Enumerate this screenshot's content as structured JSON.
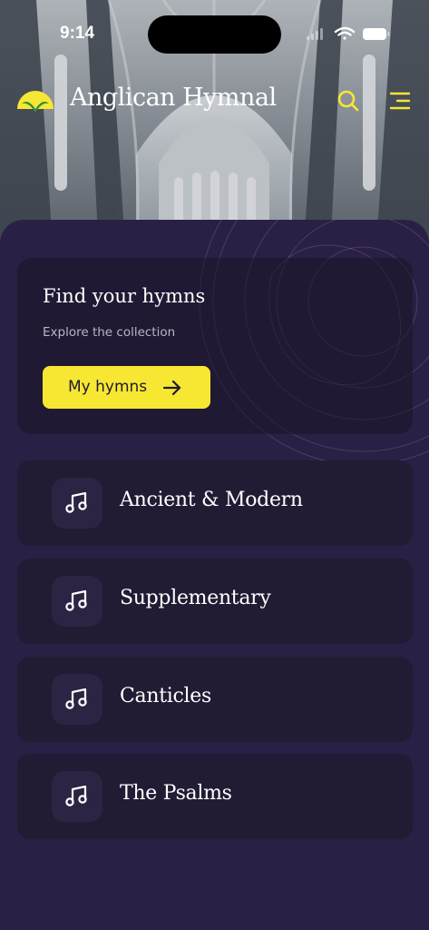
{
  "status": {
    "time": "9:14"
  },
  "app": {
    "title": "Anglican Hymnal"
  },
  "icons": {
    "logo": "sunrise-logo-icon",
    "search": "search-icon",
    "menu": "menu-icon",
    "arrow": "arrow-right-icon",
    "music": "music-note-icon"
  },
  "colors": {
    "accent": "#f7e733",
    "background": "#2a1f45",
    "card": "#211b34",
    "icon_box": "#2b2443"
  },
  "hero_card": {
    "title": "Find your hymns",
    "subtitle": "Explore the collection",
    "button_label": "My hymns"
  },
  "collections": [
    {
      "label": "Ancient & Modern"
    },
    {
      "label": "Supplementary"
    },
    {
      "label": "Canticles"
    },
    {
      "label": "The Psalms"
    }
  ]
}
